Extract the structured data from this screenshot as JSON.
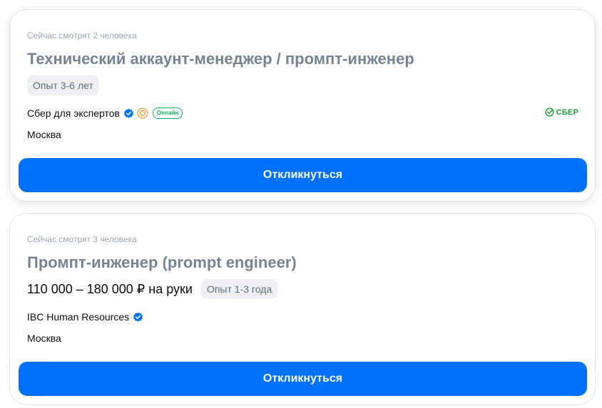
{
  "vacancies": [
    {
      "viewers": "Сейчас смотрят 2 человека",
      "title": "Технический аккаунт-менеджер / промпт-инженер",
      "experience": "Опыт 3-6 лет",
      "company": "Сбер для экспертов",
      "online_badge": "Онлайн",
      "city": "Москва",
      "logo_text": "СБЕР",
      "apply_label": "Откликнуться"
    },
    {
      "viewers": "Сейчас смотрят 3 человека",
      "title": "Промпт-инженер (prompt engineer)",
      "salary": "110 000 – 180 000 ₽ на руки",
      "experience": "Опыт 1-3 года",
      "company": "IBC Human Resources",
      "city": "Москва",
      "apply_label": "Откликнуться"
    }
  ],
  "colors": {
    "accent": "#0070ff",
    "verified": "#0070ff",
    "online": "#10b55c",
    "sber": "#21a038",
    "title": "#768394",
    "muted": "#9aa5b3"
  },
  "icons": {
    "verified": "verified-check-icon",
    "rating": "rating-badge-icon",
    "sber": "sber-logo-icon"
  }
}
